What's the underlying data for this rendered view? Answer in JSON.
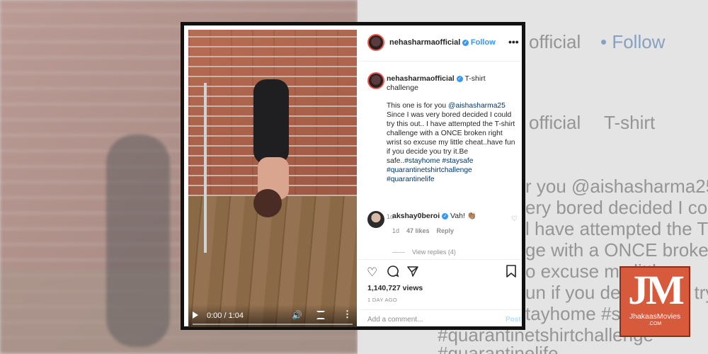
{
  "post": {
    "username": "nehasharmaofficial",
    "follow_label": "Follow",
    "more_label": "•••",
    "caption_title": "T-shirt challenge",
    "caption_mention": "@aishasharma25",
    "caption_intro": "This one is for you",
    "caption_body": "Since I was very bored decided I could try this out.. I have attempted the T-shirt challenge with a ONCE broken right wrist so excuse my little cheat..have fun if you decide you try it.Be safe..",
    "hashtags": "#stayhome #staysafe #quarantinetshirtchallenge #quarantinelife",
    "caption_age": "1d",
    "video": {
      "time": "0:00 / 1:04",
      "progress": 0
    },
    "comment": {
      "username": "akshay0beroi",
      "text": "Vah! 👏🏽",
      "age": "1d",
      "likes": "47 likes",
      "reply_label": "Reply",
      "view_replies": "View replies (4)"
    },
    "views": "1,140,727 views",
    "posted_ago": "1 DAY AGO",
    "add_comment_placeholder": "Add a comment...",
    "post_label": "Post"
  },
  "background": {
    "line1_name": "official",
    "line1_follow": "• Follow",
    "line2": "official",
    "line2_tag": "T-shirt",
    "line3": "r you @aishasharma25",
    "line4": "ery bored decided I could",
    "line5": "l have attempted the T-",
    "line6": "ge with a ONCE broken",
    "line7": "o excuse my little",
    "line8": "un if you decide you try",
    "line9": "tayhome #st",
    "line10": "#quarantinetshirtchallenge",
    "line11": "#quarantinelife"
  },
  "logo": {
    "mark": "JM",
    "name": "JhakaasMovies",
    "domain": ".COM"
  },
  "colors": {
    "accent_blue": "#3897f0",
    "logo_red": "#d75a3c"
  }
}
